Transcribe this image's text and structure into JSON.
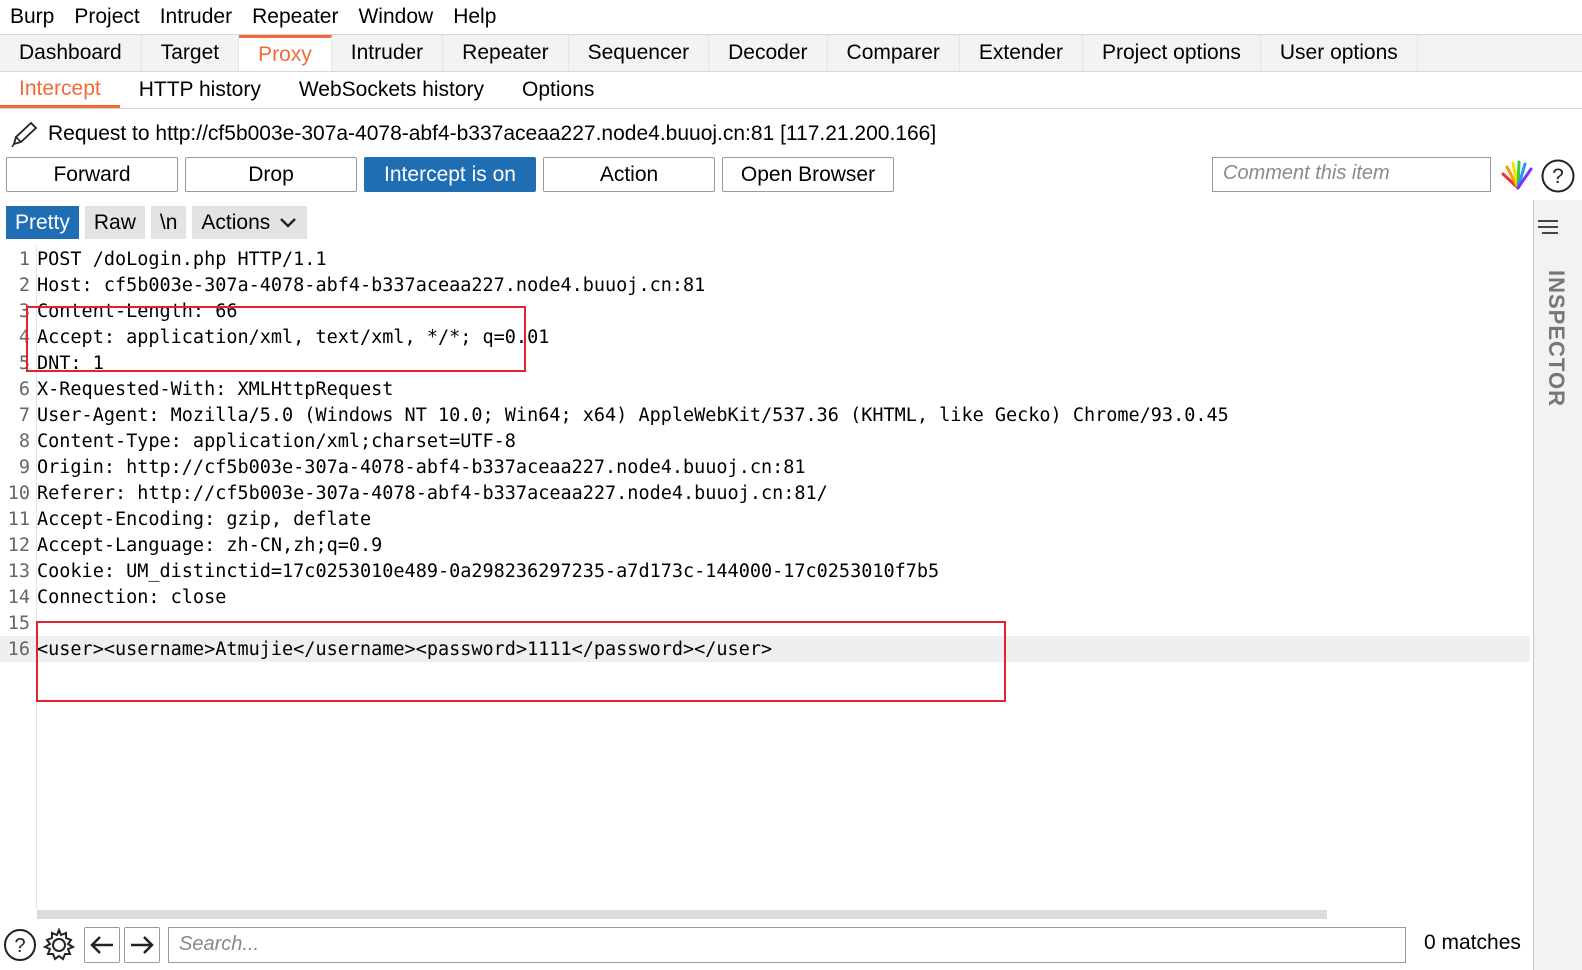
{
  "menu": [
    "Burp",
    "Project",
    "Intruder",
    "Repeater",
    "Window",
    "Help"
  ],
  "main_tabs": [
    "Dashboard",
    "Target",
    "Proxy",
    "Intruder",
    "Repeater",
    "Sequencer",
    "Decoder",
    "Comparer",
    "Extender",
    "Project options",
    "User options"
  ],
  "main_tabs_active": "Proxy",
  "sub_tabs": [
    "Intercept",
    "HTTP history",
    "WebSockets history",
    "Options"
  ],
  "sub_tabs_active": "Intercept",
  "request_info": "Request to http://cf5b003e-307a-4078-abf4-b337aceaa227.node4.buuoj.cn:81  [117.21.200.166]",
  "toolbar": {
    "forward": "Forward",
    "drop": "Drop",
    "intercept": "Intercept is on",
    "action": "Action",
    "open_browser": "Open Browser",
    "comment_placeholder": "Comment this item"
  },
  "editor_tabs": {
    "pretty": "Pretty",
    "raw": "Raw",
    "newline": "\\n",
    "actions": "Actions"
  },
  "lines": [
    "POST /doLogin.php HTTP/1.1",
    "Host: cf5b003e-307a-4078-abf4-b337aceaa227.node4.buuoj.cn:81",
    "Content-Length: 66",
    "Accept: application/xml, text/xml, */*; q=0.01",
    "DNT: 1",
    "X-Requested-With: XMLHttpRequest",
    "User-Agent: Mozilla/5.0 (Windows NT 10.0; Win64; x64) AppleWebKit/537.36 (KHTML, like Gecko) Chrome/93.0.45",
    "Content-Type: application/xml;charset=UTF-8",
    "Origin: http://cf5b003e-307a-4078-abf4-b337aceaa227.node4.buuoj.cn:81",
    "Referer: http://cf5b003e-307a-4078-abf4-b337aceaa227.node4.buuoj.cn:81/",
    "Accept-Encoding: gzip, deflate",
    "Accept-Language: zh-CN,zh;q=0.9",
    "Cookie: UM_distinctid=17c0253010e489-0a298236297235-a7d173c-144000-17c0253010f7b5",
    "Connection: close",
    "",
    "<user><username>Atmujie</username><password>1111</password></user>"
  ],
  "highlighted_line": 16,
  "inspector_label": "INSPECTOR",
  "search_placeholder": "Search...",
  "matches": "0 matches",
  "colors": {
    "accent": "#f26a38",
    "primary_button": "#1f6db3",
    "annotation": "#e0232e"
  }
}
